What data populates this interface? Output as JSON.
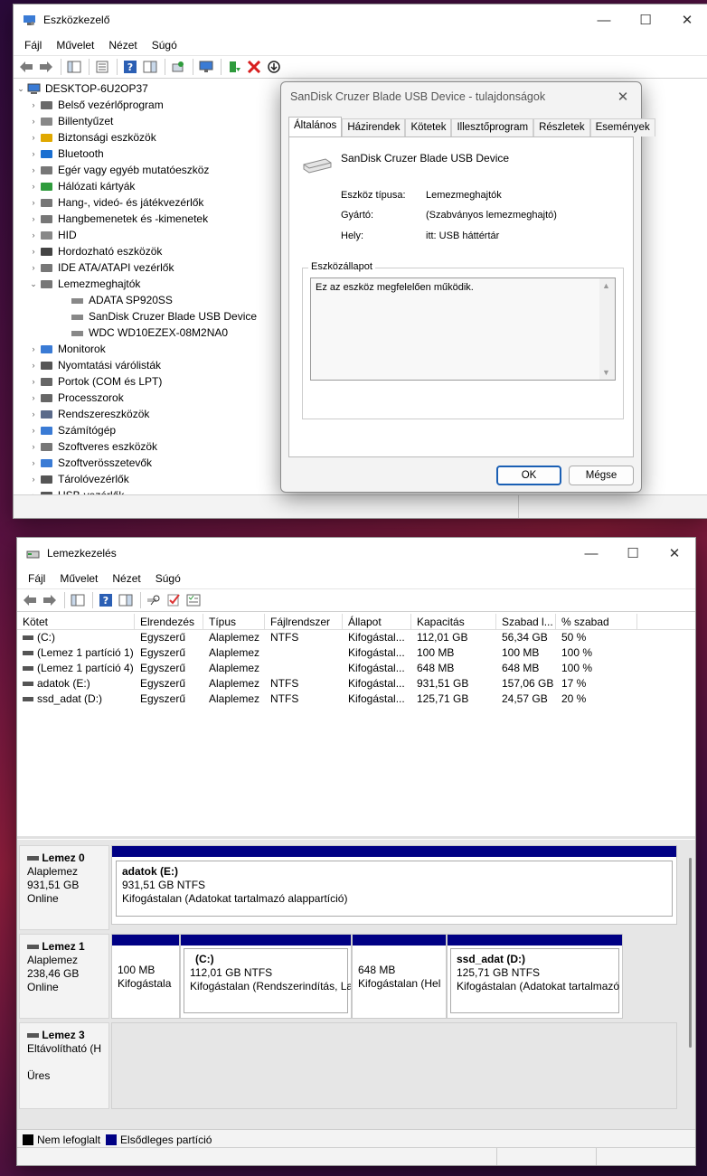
{
  "device_manager": {
    "title": "Eszközkezelő",
    "menu": [
      "Fájl",
      "Művelet",
      "Nézet",
      "Súgó"
    ],
    "tree": {
      "root": "DESKTOP-6U2OP37",
      "categories": [
        {
          "label": "Belső vezérlőprogram",
          "icon": "firmware-icon",
          "expanded": false
        },
        {
          "label": "Billentyűzet",
          "icon": "keyboard-icon",
          "expanded": false
        },
        {
          "label": "Biztonsági eszközök",
          "icon": "security-device-icon",
          "expanded": false
        },
        {
          "label": "Bluetooth",
          "icon": "bluetooth-icon",
          "expanded": false
        },
        {
          "label": "Egér vagy egyéb mutatóeszköz",
          "icon": "mouse-icon",
          "expanded": false
        },
        {
          "label": "Hálózati kártyák",
          "icon": "network-adapter-icon",
          "expanded": false
        },
        {
          "label": "Hang-, videó- és játékvezérlők",
          "icon": "speaker-icon",
          "expanded": false
        },
        {
          "label": "Hangbemenetek és -kimenetek",
          "icon": "speaker-icon",
          "expanded": false
        },
        {
          "label": "HID",
          "icon": "hid-icon",
          "expanded": false
        },
        {
          "label": "Hordozható eszközök",
          "icon": "portable-device-icon",
          "expanded": false
        },
        {
          "label": "IDE ATA/ATAPI vezérlők",
          "icon": "ide-controller-icon",
          "expanded": false
        },
        {
          "label": "Lemezmeghajtók",
          "icon": "disk-drive-icon",
          "expanded": true,
          "children": [
            "ADATA SP920SS",
            "SanDisk Cruzer Blade USB Device",
            "WDC WD10EZEX-08M2NA0"
          ]
        },
        {
          "label": "Monitorok",
          "icon": "monitor-icon",
          "expanded": false
        },
        {
          "label": "Nyomtatási várólisták",
          "icon": "printer-icon",
          "expanded": false
        },
        {
          "label": "Portok (COM és LPT)",
          "icon": "port-icon",
          "expanded": false
        },
        {
          "label": "Processzorok",
          "icon": "processor-icon",
          "expanded": false
        },
        {
          "label": "Rendszereszközök",
          "icon": "system-device-icon",
          "expanded": false
        },
        {
          "label": "Számítógép",
          "icon": "computer-icon",
          "expanded": false
        },
        {
          "label": "Szoftveres eszközök",
          "icon": "software-device-icon",
          "expanded": false
        },
        {
          "label": "Szoftverösszetevők",
          "icon": "software-component-icon",
          "expanded": false
        },
        {
          "label": "Tárolóvezérlők",
          "icon": "storage-controller-icon",
          "expanded": false
        },
        {
          "label": "USB-vezérlők",
          "icon": "usb-controller-icon",
          "expanded": false
        }
      ]
    }
  },
  "properties_dialog": {
    "title": "SanDisk Cruzer Blade USB Device - tulajdonságok",
    "tabs": [
      "Általános",
      "Házirendek",
      "Kötetek",
      "Illesztőprogram",
      "Részletek",
      "Események"
    ],
    "active_tab": "Általános",
    "device_name": "SanDisk Cruzer Blade USB Device",
    "fields": [
      {
        "label": "Eszköz típusa:",
        "value": "Lemezmeghajtók"
      },
      {
        "label": "Gyártó:",
        "value": "(Szabványos lemezmeghajtó)"
      },
      {
        "label": "Hely:",
        "value": "itt: USB háttértár"
      }
    ],
    "status_group": "Eszközállapot",
    "status_text": "Ez az eszköz megfelelően működik.",
    "ok_label": "OK",
    "cancel_label": "Mégse"
  },
  "disk_management": {
    "title": "Lemezkezelés",
    "menu": [
      "Fájl",
      "Művelet",
      "Nézet",
      "Súgó"
    ],
    "columns": [
      "Kötet",
      "Elrendezés",
      "Típus",
      "Fájlrendszer",
      "Állapot",
      "Kapacitás",
      "Szabad l...",
      "% szabad"
    ],
    "volumes": [
      [
        "(C:)",
        "Egyszerű",
        "Alaplemez",
        "NTFS",
        "Kifogástal...",
        "112,01 GB",
        "56,34 GB",
        "50 %"
      ],
      [
        "(Lemez 1 partíció 1)",
        "Egyszerű",
        "Alaplemez",
        "",
        "Kifogástal...",
        "100 MB",
        "100 MB",
        "100 %"
      ],
      [
        "(Lemez 1 partíció 4)",
        "Egyszerű",
        "Alaplemez",
        "",
        "Kifogástal...",
        "648 MB",
        "648 MB",
        "100 %"
      ],
      [
        "adatok (E:)",
        "Egyszerű",
        "Alaplemez",
        "NTFS",
        "Kifogástal...",
        "931,51 GB",
        "157,06 GB",
        "17 %"
      ],
      [
        "ssd_adat (D:)",
        "Egyszerű",
        "Alaplemez",
        "NTFS",
        "Kifogástal...",
        "125,71 GB",
        "24,57 GB",
        "20 %"
      ]
    ],
    "disks": [
      {
        "name": "Lemez 0",
        "type": "Alaplemez",
        "size": "931,51 GB",
        "state": "Online",
        "partitions": [
          {
            "title": "adatok  (E:)",
            "line1": "931,51 GB NTFS",
            "line2": "Kifogástalan (Adatokat tartalmazó alappartíció)"
          }
        ]
      },
      {
        "name": "Lemez 1",
        "type": "Alaplemez",
        "size": "238,46 GB",
        "state": "Online",
        "partitions": [
          {
            "title": "",
            "line1": "100 MB",
            "line2": "Kifogástala"
          },
          {
            "title": "(C:)",
            "line1": "112,01 GB NTFS",
            "line2": "Kifogástalan (Rendszerindítás, Laj"
          },
          {
            "title": "",
            "line1": "648 MB",
            "line2": "Kifogástalan (Hel"
          },
          {
            "title": "ssd_adat  (D:)",
            "line1": "125,71 GB NTFS",
            "line2": "Kifogástalan (Adatokat tartalmazó"
          }
        ]
      },
      {
        "name": "Lemez 3",
        "type": "Eltávolítható (H:)",
        "size": "",
        "state": "Üres",
        "partitions": []
      }
    ],
    "legend": [
      {
        "label": "Nem lefoglalt",
        "color": "#000000"
      },
      {
        "label": "Elsődleges partíció",
        "color": "#000084"
      }
    ]
  }
}
